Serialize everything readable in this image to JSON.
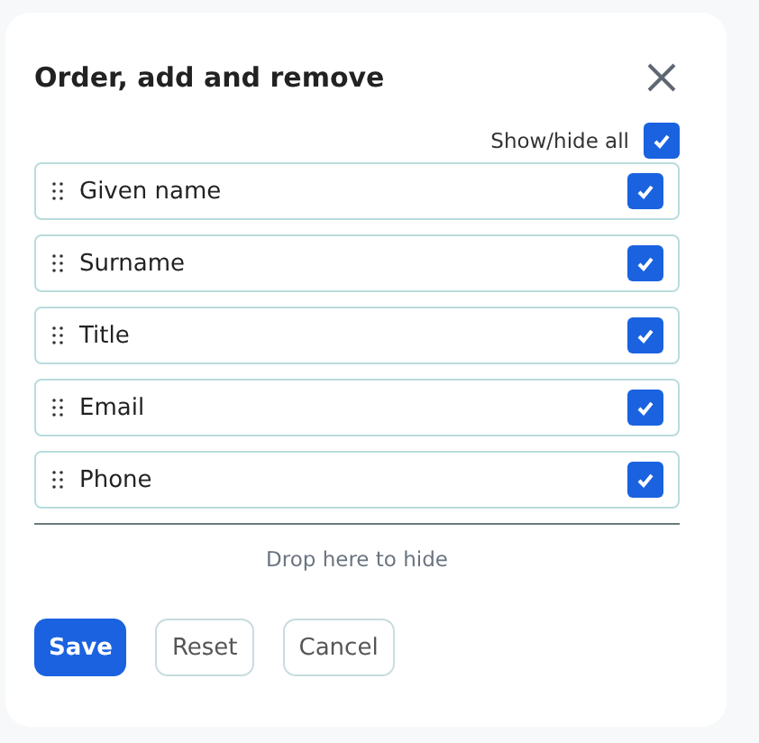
{
  "dialog": {
    "title": "Order, add and remove",
    "show_hide_all": {
      "label": "Show/hide all",
      "checked": true
    },
    "fields": [
      {
        "label": "Given name",
        "checked": true
      },
      {
        "label": "Surname",
        "checked": true
      },
      {
        "label": "Title",
        "checked": true
      },
      {
        "label": "Email",
        "checked": true
      },
      {
        "label": "Phone",
        "checked": true
      }
    ],
    "drop_zone": "Drop here to hide",
    "buttons": [
      {
        "label": "Save",
        "kind": "primary"
      },
      {
        "label": "Reset",
        "kind": "secondary"
      },
      {
        "label": "Cancel",
        "kind": "secondary"
      }
    ]
  }
}
